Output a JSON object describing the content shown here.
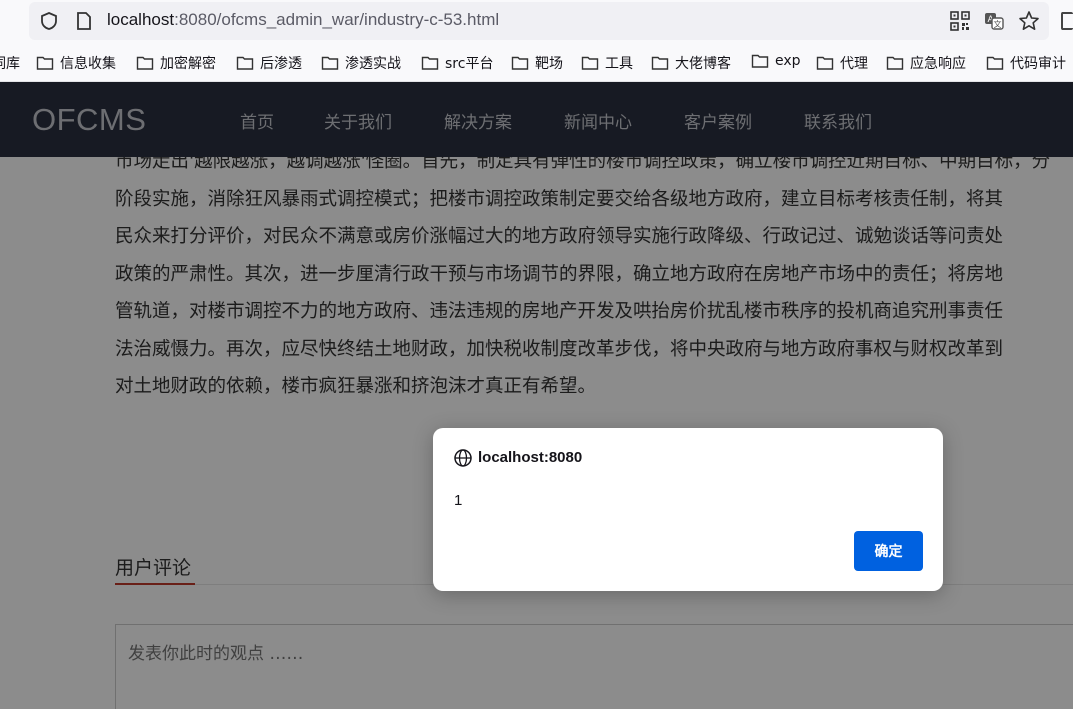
{
  "browser": {
    "url_host": "localhost",
    "url_rest": ":8080/ofcms_admin_war/industry-c-53.html",
    "bookmarks": [
      {
        "label": "词库"
      },
      {
        "label": "信息收集"
      },
      {
        "label": "加密解密"
      },
      {
        "label": "后渗透"
      },
      {
        "label": "渗透实战"
      },
      {
        "label": "src平台"
      },
      {
        "label": "靶场"
      },
      {
        "label": "工具"
      },
      {
        "label": "大佬博客"
      },
      {
        "label": "exp"
      },
      {
        "label": "代理"
      },
      {
        "label": "应急响应"
      },
      {
        "label": "代码审计"
      }
    ]
  },
  "site": {
    "logo": "OFCMS",
    "nav": [
      "首页",
      "关于我们",
      "解决方案",
      "新闻中心",
      "客户案例",
      "联系我们"
    ]
  },
  "article": {
    "lines": [
      "市场走出'越限越涨，越调越涨'怪圈。首先，制定具有弹性的楼市调控政策，确立楼市调控近期目标、中期目标，分",
      "阶段实施，消除狂风暴雨式调控模式；把楼市调控政策制定要交给各级地方政府，建立目标考核责任制，将其",
      "民众来打分评价，对民众不满意或房价涨幅过大的地方政府领导实施行政降级、行政记过、诚勉谈话等问责处",
      "政策的严肃性。其次，进一步厘清行政干预与市场调节的界限，确立地方政府在房地产市场中的责任；将房地",
      "管轨道，对楼市调控不力的地方政府、违法违规的房地产开发及哄抬房价扰乱楼市秩序的投机商追究刑事责任",
      "法治威慑力。再次，应尽快终结土地财政，加快税收制度改革步伐，将中央政府与地方政府事权与财权改革到",
      "对土地财政的依赖，楼市疯狂暴涨和挤泡沫才真正有希望。"
    ]
  },
  "comments": {
    "title": "用户评论",
    "placeholder": "发表你此时的观点 ……"
  },
  "dialog": {
    "origin": "localhost:8080",
    "message": "1",
    "ok_label": "确定",
    "ok_color": "#0061e0"
  }
}
